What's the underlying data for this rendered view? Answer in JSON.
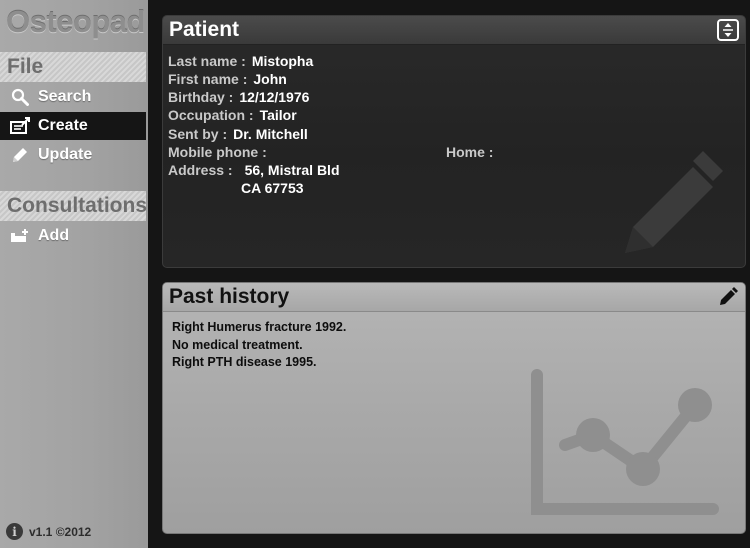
{
  "app": {
    "name": "Osteopad",
    "version": "v1.1 ©2012"
  },
  "sidebar": {
    "file_section": "File",
    "file_items": [
      {
        "label": "Search",
        "icon": "search-icon",
        "active": false
      },
      {
        "label": "Create",
        "icon": "create-icon",
        "active": true
      },
      {
        "label": "Update",
        "icon": "pencil-icon",
        "active": false
      }
    ],
    "consult_section": "Consultations",
    "consult_items": [
      {
        "label": "Add",
        "icon": "add-consultation-icon",
        "active": false
      }
    ]
  },
  "patient": {
    "title": "Patient",
    "last_name_label": "Last name :",
    "last_name": "Mistopha",
    "first_name_label": "First name :",
    "first_name": "John",
    "birthday_label": "Birthday :",
    "birthday": "12/12/1976",
    "occupation_label": "Occupation :",
    "occupation": "Tailor",
    "sent_by_label": "Sent by :",
    "sent_by": "Dr. Mitchell",
    "mobile_label": "Mobile phone :",
    "mobile": "",
    "home_label": "Home :",
    "home": "",
    "address_label": "Address :",
    "address_line1": "56, Mistral Bld",
    "address_line2": "CA 67753"
  },
  "history": {
    "title": "Past history",
    "lines": [
      "Right Humerus fracture 1992.",
      "No medical treatment.",
      "Right PTH disease 1995."
    ]
  }
}
